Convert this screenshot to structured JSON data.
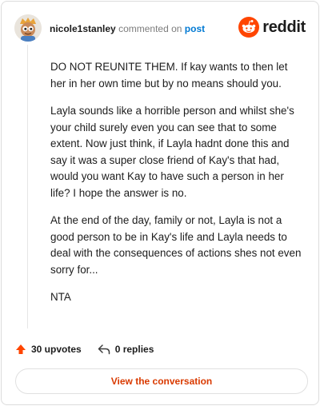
{
  "header": {
    "username": "nicole1stanley",
    "verb": "commented on",
    "post_link": "post",
    "brand": "reddit"
  },
  "comment": {
    "paragraphs": [
      "DO NOT REUNITE THEM. If kay wants to then let her in her own time but by no means should you.",
      "Layla sounds like a horrible person and whilst she's your child surely even you can see that to some extent. Now just think, if Layla hadnt done this and say it was a super close friend of Kay's that had, would you want Kay to have such a person in her life? I hope the answer is no.",
      "At the end of the day, family or not, Layla is not a good person to be in Kay's life and Layla needs to deal with the consequences of actions shes not even sorry for...",
      "NTA"
    ]
  },
  "actions": {
    "upvotes": "30 upvotes",
    "replies": "0 replies"
  },
  "cta": {
    "label": "View the conversation"
  },
  "colors": {
    "brand_orange": "#ff4500",
    "link_blue": "#0079d3",
    "cta_text": "#d93a00"
  },
  "icons": {
    "avatar": "snoo-avatar",
    "brand": "reddit-logo-icon",
    "upvote": "upvote-arrow-icon",
    "reply": "reply-arrow-icon"
  }
}
